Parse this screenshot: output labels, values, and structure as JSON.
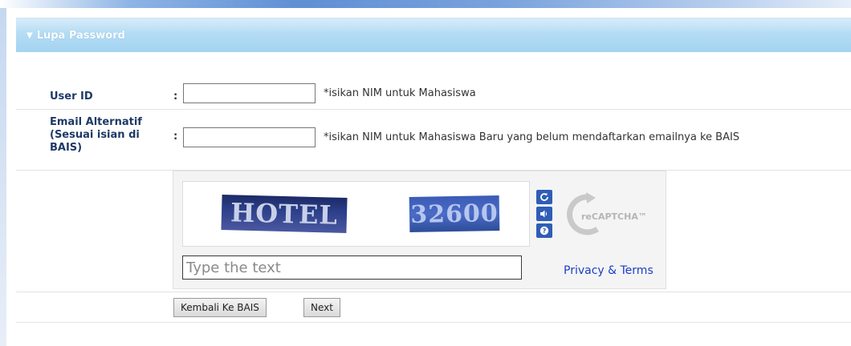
{
  "panel": {
    "title": "Lupa Password"
  },
  "form": {
    "user_id": {
      "label": "User ID",
      "colon": ":",
      "value": "",
      "hint": "*isikan NIM untuk Mahasiswa"
    },
    "email": {
      "label_line1": "Email Alternatif",
      "label_line2": "(Sesuai isian di",
      "label_line3": "BAIS)",
      "colon": ":",
      "value": "",
      "hint": "*isikan NIM untuk Mahasiswa Baru yang belum mendaftarkan emailnya ke BAIS"
    }
  },
  "captcha": {
    "word1": "HOTEL",
    "word2": "32600",
    "input_placeholder": "Type the text",
    "privacy_link": "Privacy & Terms",
    "logo_text": "reCAPTCHA™",
    "buttons": [
      "refresh-icon",
      "audio-icon",
      "help-icon"
    ]
  },
  "actions": {
    "back_label": "Kembali Ke BAIS",
    "next_label": "Next"
  },
  "colors": {
    "header_blue": "#a3d3f1",
    "label_navy": "#1f3a66",
    "link_blue": "#1a3ec7",
    "recaptcha_button": "#2f5db7"
  }
}
